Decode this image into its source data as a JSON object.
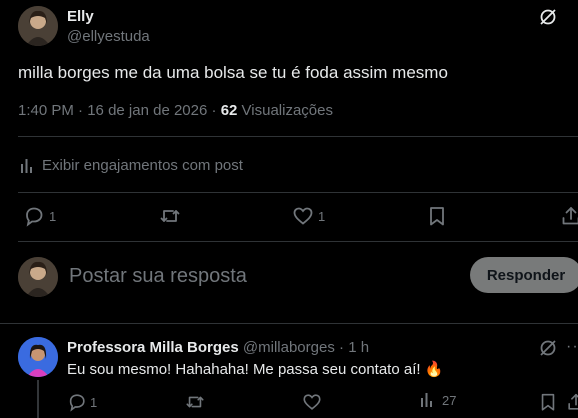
{
  "tweet": {
    "author_name": "Elly",
    "author_handle": "@ellyestuda",
    "text": "milla borges me da uma bolsa se tu é foda assim mesmo",
    "time": "1:40 PM",
    "separator1": " · ",
    "date": "16 de jan de 2026",
    "separator2": " · ",
    "views_count": "62",
    "views_label": "Visualizações",
    "engagement_label": "Exibir engajamentos com post",
    "reply_count": "1",
    "like_count": "1"
  },
  "composer": {
    "placeholder": "Postar sua resposta",
    "reply_button": "Responder"
  },
  "reply": {
    "author_name": "Professora Milla Borges",
    "author_handle": "@millaborges",
    "separator": " · ",
    "time": "1 h",
    "text": "Eu sou mesmo! Hahahaha! Me passa seu contato aí!",
    "emoji": "🔥",
    "reply_count": "1",
    "views_count": "27"
  },
  "colors": {
    "background": "#000000",
    "text": "#e7e9ea",
    "muted": "#71767b",
    "divider": "#2f3336",
    "accent_reply_button": "#787a7a"
  },
  "icons": [
    "grok-icon",
    "analytics-icon",
    "reply-icon",
    "retweet-icon",
    "like-icon",
    "bookmark-icon",
    "share-icon",
    "views-icon"
  ]
}
